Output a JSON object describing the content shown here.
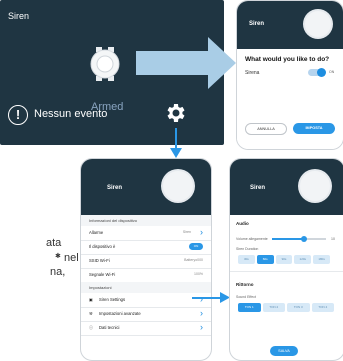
{
  "dark_card": {
    "title": "Siren",
    "status": "Nessun evento",
    "armed": "Armed"
  },
  "dialog_phone": {
    "header_title": "Siren",
    "question": "What would you like to do?",
    "row_label": "Sirena",
    "toggle_label": "ON",
    "cancel_label": "ANNULLA",
    "confirm_label": "IMPOSTA"
  },
  "settings_phone": {
    "header_title": "Siren",
    "section_device_info": "Informazioni del dispositivo",
    "rows": [
      {
        "label": "Allarme",
        "value": "Siren"
      },
      {
        "label": "Il dispositivo è",
        "value": "ON"
      },
      {
        "label": "SSID Wi-Fi",
        "value": "Batteryo000"
      },
      {
        "label": "Segnale Wi-Fi",
        "value": "100%"
      }
    ],
    "section_settings": "Impostazioni",
    "menu": [
      {
        "label": "Siren Settings",
        "icon": "siren-settings-icon"
      },
      {
        "label": "Impostazioni avanzate",
        "icon": "wrench-icon"
      },
      {
        "label": "Dati tecnici",
        "icon": "info-icon"
      }
    ]
  },
  "audio_phone": {
    "header_title": "Siren",
    "section_audio": "Audio",
    "volume_label": "Volume allegamente",
    "volume_value": "10",
    "volume_level": 0.6,
    "duration_label": "Siren Duration",
    "durations": [
      "30s",
      "60s",
      "90s",
      "120s",
      "180s"
    ],
    "selected_duration": 1,
    "section_ringtone": "Rittorno",
    "sound_label": "Sound Effect",
    "tones": [
      "TON 1",
      "TON 2",
      "TON 3",
      "TON 4"
    ],
    "selected_tone": 0,
    "save_label": "SALVA"
  },
  "side_text": {
    "line1": "ata",
    "line2": "nel",
    "line3": "na,"
  },
  "colors": {
    "dark": "#1f3542",
    "accent": "#2a97e6"
  }
}
